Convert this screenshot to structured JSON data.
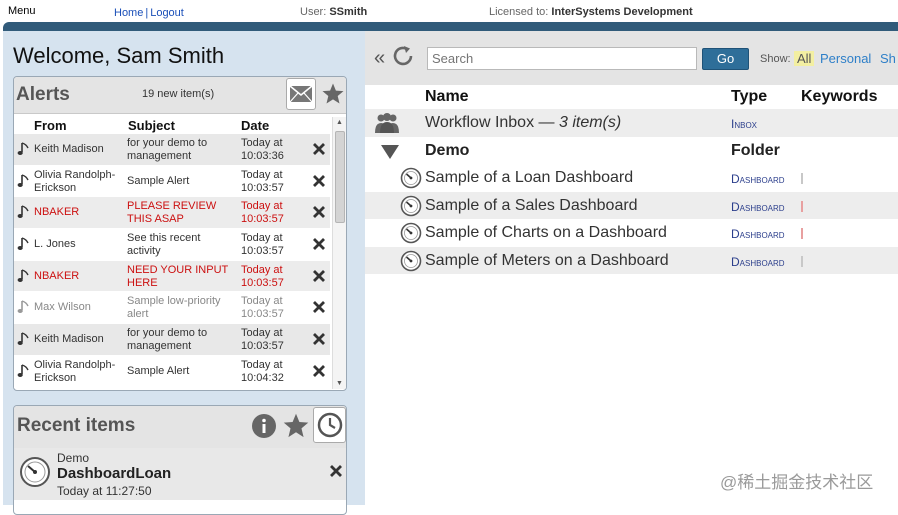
{
  "topbar": {
    "menu": "Menu",
    "home": "Home",
    "separator": "|",
    "logout": "Logout",
    "user_label": "User:",
    "user_name": "SSmith",
    "license_label": "Licensed to:",
    "license_name": "InterSystems Development"
  },
  "welcome": "Welcome, Sam Smith",
  "alerts": {
    "title": "Alerts",
    "count": "19 new item(s)",
    "columns": {
      "from": "From",
      "subject": "Subject",
      "date": "Date"
    },
    "rows": [
      {
        "from": "Keith Madison",
        "subject": "for your demo to management",
        "date": "Today at 10:03:36",
        "style": "normal"
      },
      {
        "from": "Olivia Randolph-Erickson",
        "subject": "Sample Alert",
        "date": "Today at 10:03:57",
        "style": "normal"
      },
      {
        "from": "NBAKER",
        "subject": "PLEASE REVIEW THIS ASAP",
        "date": "Today at 10:03:57",
        "style": "urgent"
      },
      {
        "from": "L. Jones",
        "subject": "See this recent activity",
        "date": "Today at 10:03:57",
        "style": "normal"
      },
      {
        "from": "NBAKER",
        "subject": "NEED YOUR INPUT HERE",
        "date": "Today at 10:03:57",
        "style": "urgent"
      },
      {
        "from": "Max Wilson",
        "subject": "Sample low-priority alert",
        "date": "Today at 10:03:57",
        "style": "low"
      },
      {
        "from": "Keith Madison",
        "subject": "for your demo to management",
        "date": "Today at 10:03:57",
        "style": "normal"
      },
      {
        "from": "Olivia Randolph-Erickson",
        "subject": "Sample Alert",
        "date": "Today at 10:04:32",
        "style": "normal"
      }
    ]
  },
  "recent": {
    "title": "Recent items",
    "item": {
      "folder": "Demo",
      "name": "DashboardLoan",
      "when": "Today at 11:27:50"
    }
  },
  "toolbar": {
    "back": "«",
    "search_placeholder": "Search",
    "go": "Go",
    "show_label": "Show:",
    "all": "All",
    "personal": "Personal",
    "shared": "Sh"
  },
  "grid": {
    "headers": {
      "name": "Name",
      "type": "Type",
      "keywords": "Keywords"
    },
    "workflow": {
      "name": "Workflow Inbox — ",
      "count": "3 item(s)",
      "type": "Inbox"
    },
    "folder": {
      "name": "Demo",
      "type": "Folder"
    },
    "items": [
      {
        "name": "Sample of a Loan Dashboard",
        "type": "Dashboard"
      },
      {
        "name": "Sample of a Sales Dashboard",
        "type": "Dashboard"
      },
      {
        "name": "Sample of Charts on a Dashboard",
        "type": "Dashboard"
      },
      {
        "name": "Sample of Meters on a Dashboard",
        "type": "Dashboard"
      }
    ]
  },
  "watermark": "@稀土掘金技术社区",
  "colors": {
    "header_band": "#315b7a",
    "go_button": "#2e6e99",
    "link": "#2e7fc8",
    "urgent": "#cc1010",
    "panel": "#d6e3ef"
  }
}
